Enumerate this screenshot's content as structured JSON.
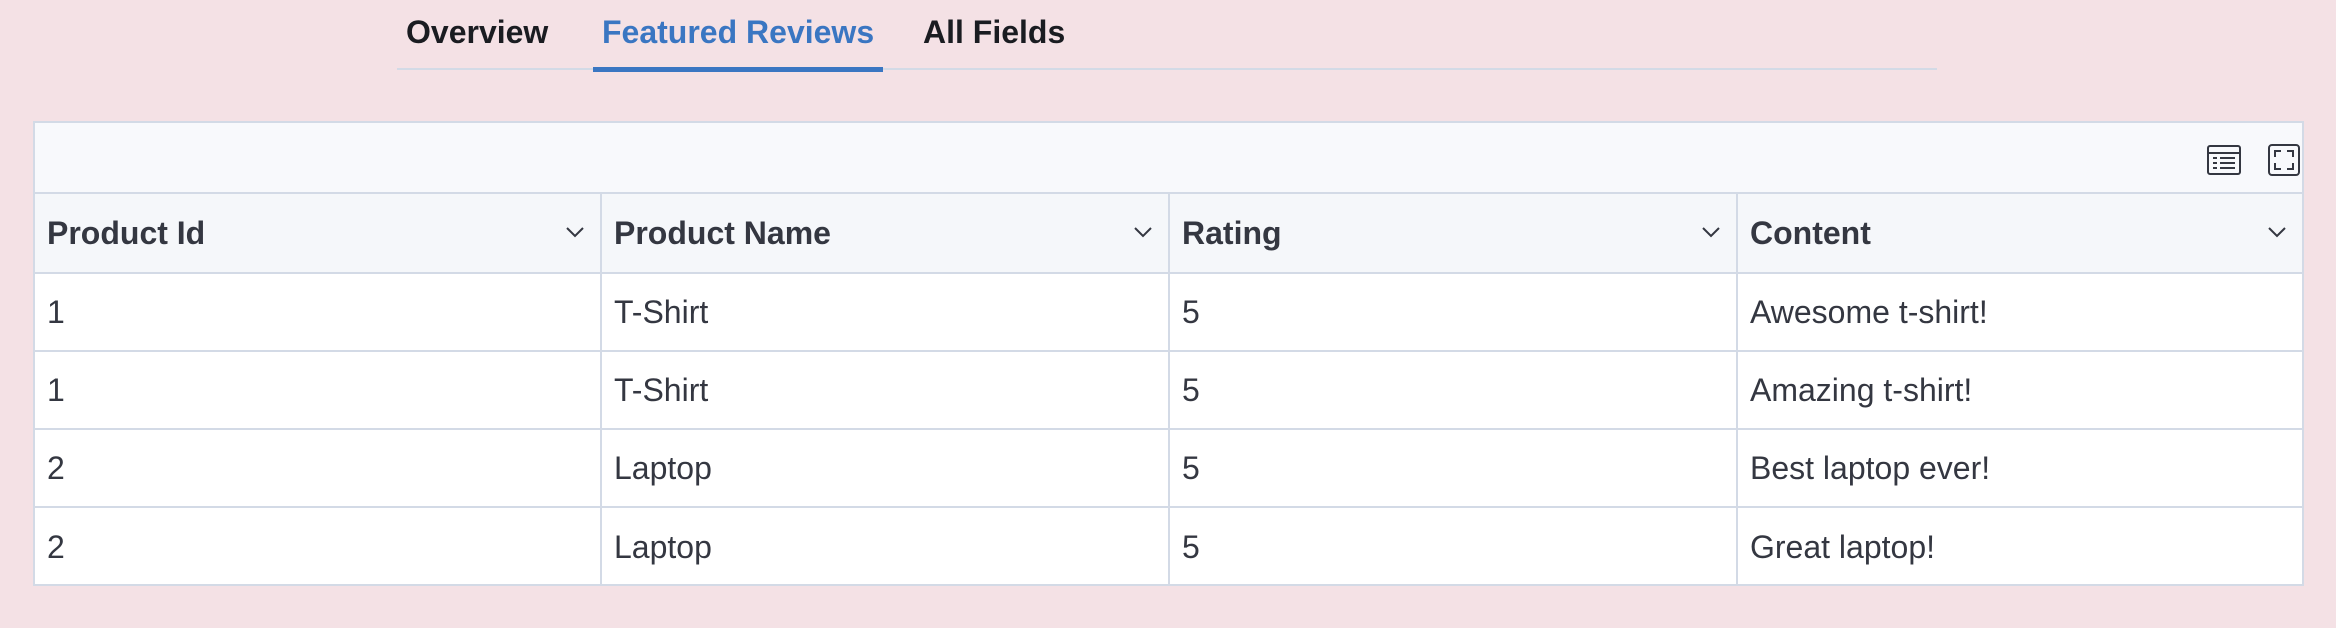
{
  "tabs": [
    {
      "label": "Overview",
      "active": false
    },
    {
      "label": "Featured Reviews",
      "active": true
    },
    {
      "label": "All Fields",
      "active": false
    }
  ],
  "toolbar": {
    "density_icon": "table-density-icon",
    "fullscreen_icon": "fullscreen-icon"
  },
  "grid": {
    "columns": [
      "Product Id",
      "Product Name",
      "Rating",
      "Content"
    ],
    "rows": [
      [
        "1",
        "T-Shirt",
        "5",
        "Awesome t-shirt!"
      ],
      [
        "1",
        "T-Shirt",
        "5",
        "Amazing t-shirt!"
      ],
      [
        "2",
        "Laptop",
        "5",
        "Best laptop ever!"
      ],
      [
        "2",
        "Laptop",
        "5",
        "Great laptop!"
      ]
    ]
  },
  "colors": {
    "background": "#f4e1e5",
    "accent": "#3a76c2",
    "border": "#d3dae6",
    "text": "#343741"
  }
}
